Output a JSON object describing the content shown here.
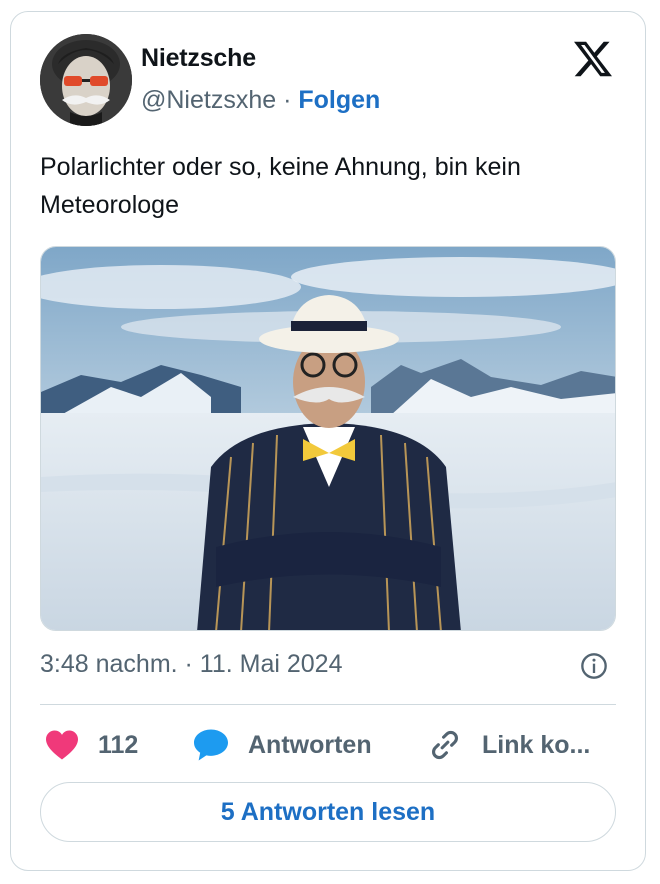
{
  "author": {
    "name": "Nietzsche",
    "handle": "@Nietzsxhe",
    "separator": "·",
    "follow_label": "Folgen"
  },
  "tweet": {
    "text": "Polarlichter oder so, keine Ahnung, bin kein Meteorologe",
    "timestamp": "3:48 nachm. · 11. Mai 2024"
  },
  "actions": {
    "likes_count": "112",
    "reply_label": "Antworten",
    "link_label": "Link ko..."
  },
  "read_replies_label": "5 Antworten lesen",
  "icons": {
    "logo": "x-logo-icon",
    "info": "info-icon",
    "like": "heart-icon",
    "reply": "speech-bubble-icon",
    "link": "link-icon"
  },
  "colors": {
    "accent": "#1d6fc4",
    "like": "#f0397a",
    "reply": "#1d9bf0",
    "muted": "#536471",
    "border": "#cfd9de"
  }
}
